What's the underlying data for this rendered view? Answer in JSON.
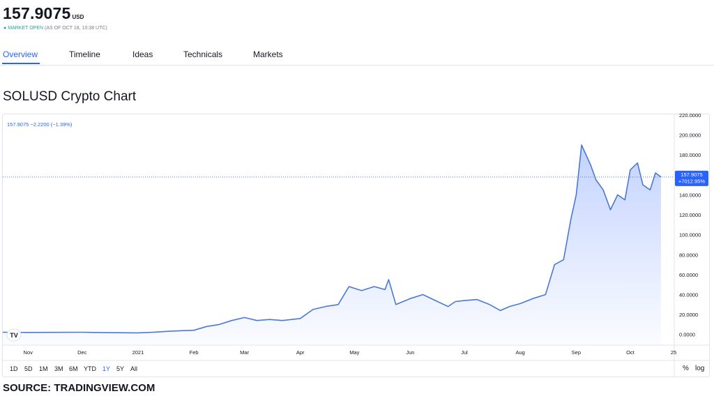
{
  "header": {
    "price": "157.9075",
    "currency": "USD",
    "status_label": "MARKET OPEN",
    "status_time": "(AS OF OCT 18, 10:38 UTC)"
  },
  "tabs": [
    {
      "label": "Overview",
      "active": true
    },
    {
      "label": "Timeline"
    },
    {
      "label": "Ideas"
    },
    {
      "label": "Technicals"
    },
    {
      "label": "Markets"
    }
  ],
  "chart_title": "SOLUSD Crypto Chart",
  "legend_text": "157.9075 −2.2200 (−1.39%)",
  "range_buttons": [
    "1D",
    "5D",
    "1M",
    "3M",
    "6M",
    "YTD",
    "1Y",
    "5Y",
    "All"
  ],
  "active_range": "1Y",
  "toggles": [
    "%",
    "log"
  ],
  "source": "SOURCE: TRADINGVIEW.COM",
  "colors": {
    "accent": "#2962ff",
    "line": "#4a78d4",
    "label_bg": "#2962ff",
    "market_open": "#26a69a"
  },
  "chart_data": {
    "type": "area",
    "ylim": [
      -10,
      220
    ],
    "yticks": [
      "220.0000",
      "200.0000",
      "180.0000",
      "160.0000",
      "140.0000",
      "120.0000",
      "100.0000",
      "80.0000",
      "60.0000",
      "40.0000",
      "20.0000",
      "0.0000"
    ],
    "ytick_values": [
      220,
      200,
      180,
      160,
      140,
      120,
      100,
      80,
      60,
      40,
      20,
      0
    ],
    "xticks": [
      "Nov",
      "Dec",
      "2021",
      "Feb",
      "Mar",
      "Apr",
      "May",
      "Jun",
      "Jul",
      "Aug",
      "Sep",
      "Oct",
      "25"
    ],
    "xtick_dates": [
      "2020-11-01",
      "2020-12-01",
      "2021-01-01",
      "2021-02-01",
      "2021-03-01",
      "2021-04-01",
      "2021-05-01",
      "2021-06-01",
      "2021-07-01",
      "2021-08-01",
      "2021-09-01",
      "2021-10-01",
      "2021-10-25"
    ],
    "xlim": [
      "2020-10-18",
      "2021-10-25"
    ],
    "last_value_label": "157.9075",
    "last_change_label": "+7012.95%",
    "last_value": 157.9075,
    "series": [
      {
        "x": [
          "2020-10-18",
          "2020-11-01",
          "2020-11-15",
          "2020-12-01",
          "2020-12-15",
          "2021-01-01",
          "2021-01-10",
          "2021-01-20",
          "2021-02-01",
          "2021-02-08",
          "2021-02-15",
          "2021-02-22",
          "2021-03-01",
          "2021-03-08",
          "2021-03-15",
          "2021-03-22",
          "2021-04-01",
          "2021-04-08",
          "2021-04-15",
          "2021-04-22",
          "2021-04-28",
          "2021-05-05",
          "2021-05-12",
          "2021-05-18",
          "2021-05-20",
          "2021-05-24",
          "2021-06-01",
          "2021-06-08",
          "2021-06-15",
          "2021-06-22",
          "2021-06-26",
          "2021-07-01",
          "2021-07-08",
          "2021-07-15",
          "2021-07-21",
          "2021-07-26",
          "2021-08-01",
          "2021-08-08",
          "2021-08-15",
          "2021-08-20",
          "2021-08-25",
          "2021-08-29",
          "2021-09-01",
          "2021-09-04",
          "2021-09-09",
          "2021-09-12",
          "2021-09-16",
          "2021-09-20",
          "2021-09-24",
          "2021-09-28",
          "2021-10-01",
          "2021-10-05",
          "2021-10-08",
          "2021-10-12",
          "2021-10-15",
          "2021-10-18"
        ],
        "values": [
          2.2,
          2.0,
          2.1,
          2.2,
          1.8,
          1.6,
          2.3,
          3.4,
          4.2,
          8.0,
          10.0,
          14.0,
          17.0,
          14.0,
          15.0,
          14.0,
          16.0,
          25.0,
          28.0,
          30.0,
          48.0,
          44.0,
          48.0,
          45.0,
          55.0,
          30.0,
          36.0,
          40.0,
          34.0,
          28.0,
          33.0,
          34.0,
          35.0,
          30.0,
          24.0,
          28.0,
          31.0,
          36.0,
          40.0,
          70.0,
          75.0,
          115.0,
          140.0,
          190.0,
          170.0,
          155.0,
          145.0,
          125.0,
          140.0,
          135.0,
          165.0,
          172.0,
          150.0,
          145.0,
          162.0,
          157.9
        ]
      }
    ]
  }
}
